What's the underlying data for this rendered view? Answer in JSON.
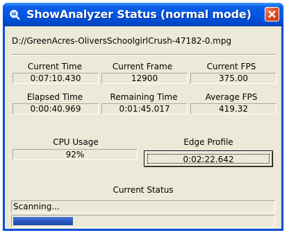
{
  "window": {
    "title": "ShowAnalyzer Status (normal mode)"
  },
  "file": {
    "path": "D://GreenAcres-OliversSchoolgirlCrush-47182-0.mpg"
  },
  "stats": {
    "current_time_label": "Current Time",
    "current_time_value": "0:07:10.430",
    "current_frame_label": "Current Frame",
    "current_frame_value": "12900",
    "current_fps_label": "Current FPS",
    "current_fps_value": "375.00",
    "elapsed_time_label": "Elapsed Time",
    "elapsed_time_value": "0:00:40.969",
    "remaining_time_label": "Remaining Time",
    "remaining_time_value": "0:01:45.017",
    "average_fps_label": "Average FPS",
    "average_fps_value": "419.32",
    "cpu_usage_label": "CPU Usage",
    "cpu_usage_value": "92%",
    "edge_profile_label": "Edge Profile",
    "edge_profile_value": "0:02:22.642"
  },
  "status": {
    "label": "Current Status",
    "text": "Scanning...",
    "progress_fraction": 0.23
  },
  "colors": {
    "titlebar": "#0055e5",
    "face": "#ece9d8",
    "progress": "#2a58c0",
    "close": "#e0502a"
  }
}
